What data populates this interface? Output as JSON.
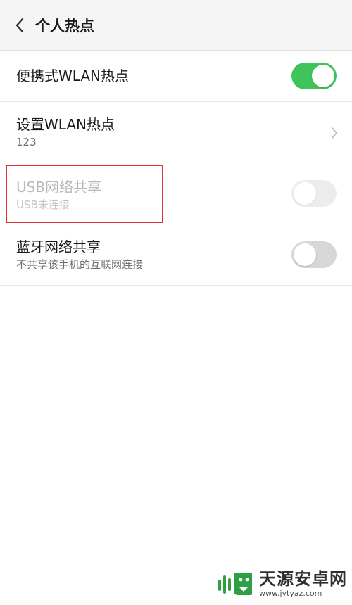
{
  "header": {
    "title": "个人热点",
    "back_icon": "chevron-left-icon"
  },
  "rows": [
    {
      "label": "便携式WLAN热点",
      "control": "toggle",
      "toggle_on": true,
      "enabled": true
    },
    {
      "label": "设置WLAN热点",
      "sublabel": "123",
      "control": "chevron",
      "enabled": true
    },
    {
      "label": "USB网络共享",
      "sublabel": "USB未连接",
      "control": "toggle",
      "toggle_on": false,
      "enabled": false
    },
    {
      "label": "蓝牙网络共享",
      "sublabel": "不共享该手机的互联网连接",
      "control": "toggle",
      "toggle_on": false,
      "enabled": true
    }
  ],
  "colors": {
    "toggle_on": "#3ec45a",
    "toggle_off": "#d7d7d7",
    "highlight_box": "#e0302f",
    "header_bg": "#f5f5f5"
  },
  "watermark": {
    "title": "天源安卓网",
    "url": "www.jytyaz.com"
  }
}
